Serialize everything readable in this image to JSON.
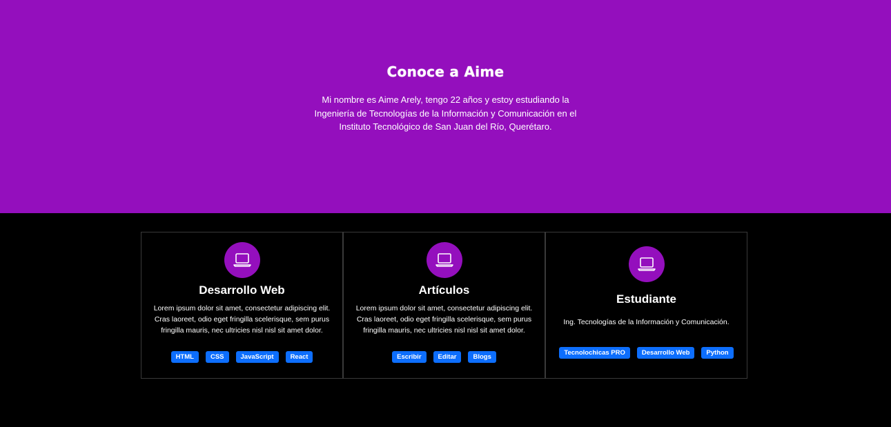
{
  "hero": {
    "title": "Conoce a Aime",
    "description": "Mi nombre es Aime Arely, tengo 22 años y estoy estudiando la Ingeniería de Tecnologías de la Información y Comunicación en el Instituto Tecnológico de San Juan del Río, Querétaro.",
    "background_color": "#940fbd"
  },
  "cards": [
    {
      "icon": "laptop-icon",
      "title": "Desarrollo Web",
      "text": "Lorem ipsum dolor sit amet, consectetur adipiscing elit. Cras laoreet, odio eget fringilla scelerisque, sem purus fringilla mauris, nec ultricies nisl nisl sit amet dolor.",
      "tags": [
        "HTML",
        "CSS",
        "JavaScript",
        "React"
      ]
    },
    {
      "icon": "laptop-icon",
      "title": "Artículos",
      "text": "Lorem ipsum dolor sit amet, consectetur adipiscing elit. Cras laoreet, odio eget fringilla scelerisque, sem purus fringilla mauris, nec ultricies nisl nisl sit amet dolor.",
      "tags": [
        "Escribir",
        "Editar",
        "Blogs"
      ]
    },
    {
      "icon": "laptop-icon",
      "title": "Estudiante",
      "text": "Ing. Tecnologías de la Información y Comunicación.",
      "tags": [
        "Tecnolochicas PRO",
        "Desarrollo Web",
        "Python"
      ]
    }
  ],
  "colors": {
    "accent": "#940fbd",
    "tag": "#0d6efd",
    "background": "#000000"
  }
}
